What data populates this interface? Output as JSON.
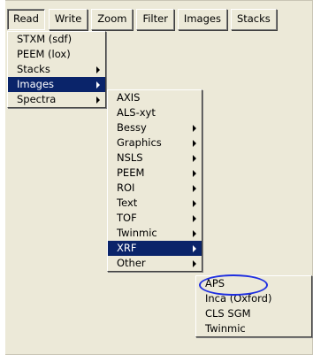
{
  "menubar": {
    "items": [
      "Read",
      "Write",
      "Zoom",
      "Filter",
      "Images",
      "Stacks"
    ]
  },
  "read_menu": {
    "items": [
      {
        "label": "STXM (sdf)",
        "submenu": false
      },
      {
        "label": "PEEM (lox)",
        "submenu": false
      },
      {
        "label": "Stacks",
        "submenu": true
      },
      {
        "label": "Images",
        "submenu": true,
        "selected": true
      },
      {
        "label": "Spectra",
        "submenu": true
      }
    ]
  },
  "images_menu": {
    "items": [
      {
        "label": "AXIS",
        "submenu": false
      },
      {
        "label": "ALS-xyt",
        "submenu": false
      },
      {
        "label": "Bessy",
        "submenu": true
      },
      {
        "label": "Graphics",
        "submenu": true
      },
      {
        "label": "NSLS",
        "submenu": true
      },
      {
        "label": "PEEM",
        "submenu": true
      },
      {
        "label": "ROI",
        "submenu": true
      },
      {
        "label": "Text",
        "submenu": true
      },
      {
        "label": "TOF",
        "submenu": true
      },
      {
        "label": "Twinmic",
        "submenu": true
      },
      {
        "label": "XRF",
        "submenu": true,
        "selected": true
      },
      {
        "label": "Other",
        "submenu": true
      }
    ]
  },
  "xrf_menu": {
    "items": [
      {
        "label": "APS",
        "highlighted_annotation": true
      },
      {
        "label": "Inca (Oxford)"
      },
      {
        "label": "CLS SGM"
      },
      {
        "label": "Twinmic"
      }
    ]
  },
  "colors": {
    "menu_bg": "#ece9d8",
    "selection_bg": "#0a246a",
    "annotation": "#1f2fe0"
  }
}
